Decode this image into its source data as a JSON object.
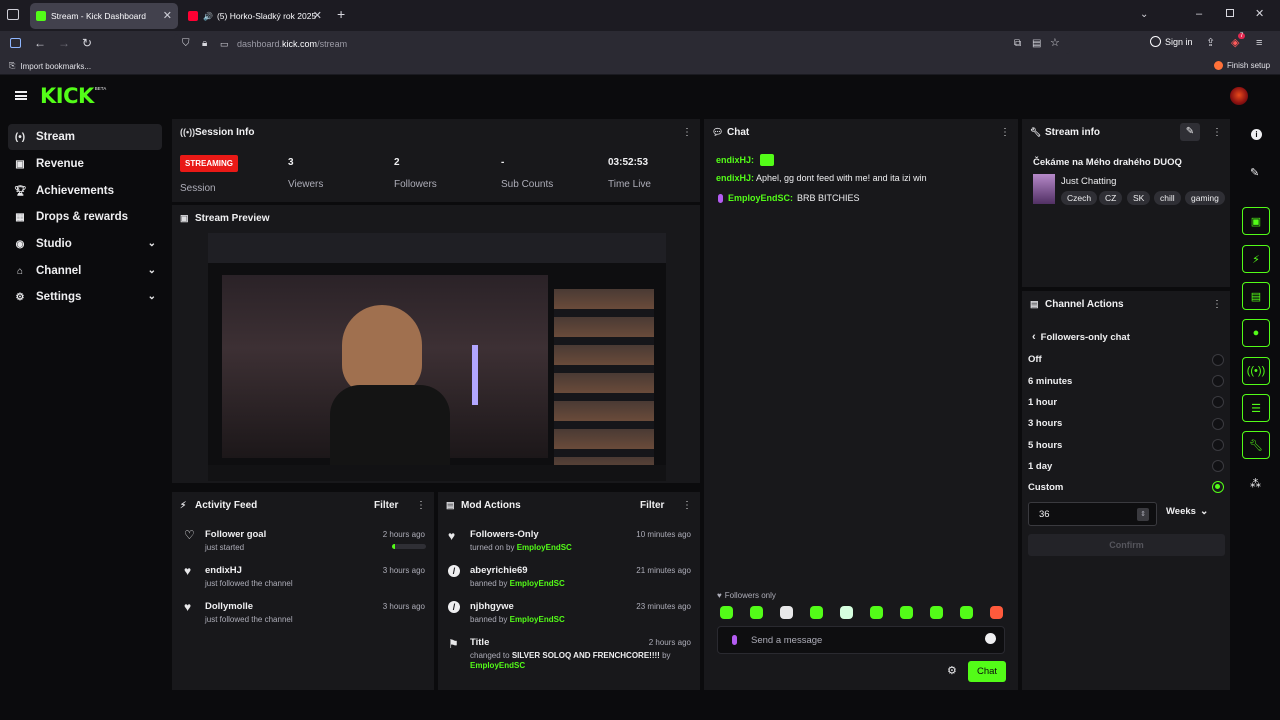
{
  "browser": {
    "tabs": [
      {
        "title": "Stream - Kick Dashboard",
        "active": true
      },
      {
        "title": "(5) Horko-Sladký rok 2025",
        "active": false
      }
    ],
    "url_host": "dashboard.",
    "url_domain": "kick.com",
    "url_path": "/stream",
    "sign_in": "Sign in",
    "bookmarks": {
      "import": "Import bookmarks...",
      "finish": "Finish setup"
    },
    "notif_badge": "7"
  },
  "site": {
    "logo": "KICK",
    "logo_sup": "BETA",
    "brand_color": "#53fc18",
    "nav": [
      {
        "label": "Stream",
        "icon": "stream-icon",
        "selected": true
      },
      {
        "label": "Revenue",
        "icon": "revenue-icon"
      },
      {
        "label": "Achievements",
        "icon": "trophy-icon"
      },
      {
        "label": "Drops & rewards",
        "icon": "gift-icon"
      },
      {
        "label": "Studio",
        "icon": "studio-icon",
        "expandable": true
      },
      {
        "label": "Channel",
        "icon": "channel-icon",
        "expandable": true
      },
      {
        "label": "Settings",
        "icon": "gear-icon",
        "expandable": true
      }
    ]
  },
  "session": {
    "title": "Session Info",
    "status": "STREAMING",
    "session_label": "Session",
    "viewers": "3",
    "viewers_label": "Viewers",
    "followers": "2",
    "followers_label": "Followers",
    "subs": "-",
    "subs_label": "Sub Counts",
    "time": "03:52:53",
    "time_label": "Time Live"
  },
  "preview": {
    "title": "Stream Preview"
  },
  "activity": {
    "title": "Activity Feed",
    "filter": "Filter",
    "items": [
      {
        "title": "Follower goal",
        "sub": "just started",
        "time": "2 hours ago",
        "progress": 0.08
      },
      {
        "title": "endixHJ",
        "sub": "just followed the channel",
        "time": "3 hours ago"
      },
      {
        "title": "Dollymolle",
        "sub": "just followed the channel",
        "time": "3 hours ago"
      }
    ]
  },
  "mod": {
    "title": "Mod Actions",
    "filter": "Filter",
    "items": [
      {
        "title": "Followers-Only",
        "pre": "turned on by",
        "user": "EmployEndSC",
        "time": "10 minutes ago"
      },
      {
        "title": "abeyrichie69",
        "pre": "banned by",
        "user": "EmployEndSC",
        "time": "21 minutes ago"
      },
      {
        "title": "njbhgywe",
        "pre": "banned by",
        "user": "EmployEndSC",
        "time": "23 minutes ago"
      },
      {
        "title": "Title",
        "pre": "changed to",
        "value": "SILVER SOLOQ AND FRENCHCORE!!!!",
        "by": "by",
        "user": "EmployEndSC",
        "time": "2 hours ago"
      }
    ]
  },
  "chat": {
    "title": "Chat",
    "messages": [
      {
        "user": "endixHJ:",
        "text": ""
      },
      {
        "user": "endixHJ:",
        "text": "Aphel, gg dont feed with me! and ita izi win"
      },
      {
        "user": "EmployEndSC:",
        "text": "BRB BITCHIES"
      }
    ],
    "followers_only": "Followers only",
    "placeholder": "Send a message",
    "send": "Chat"
  },
  "stream_info": {
    "title": "Stream info",
    "stream_title": "Čekáme na Mého drahého DUOQ",
    "category": "Just Chatting",
    "tags": [
      "Czech",
      "CZ",
      "SK",
      "chill",
      "gaming"
    ]
  },
  "channel_actions": {
    "title": "Channel Actions",
    "back_label": "Followers-only chat",
    "options": [
      "Off",
      "6 minutes",
      "1 hour",
      "3 hours",
      "5 hours",
      "1 day",
      "Custom"
    ],
    "selected": "Custom",
    "custom_value": "36",
    "unit": "Weeks",
    "confirm": "Confirm"
  }
}
